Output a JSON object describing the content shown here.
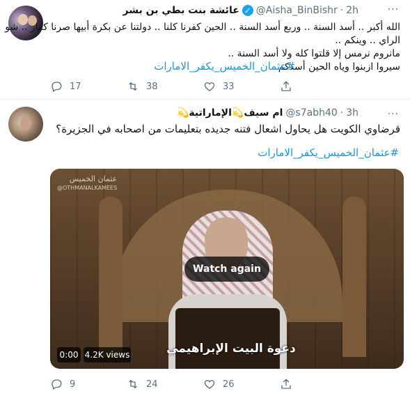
{
  "tweet1": {
    "name": "عائشة بنت بطي بن بشر",
    "handle": "@Aisha_BinBishr",
    "dot": "·",
    "time": "2h",
    "more": "···",
    "lines": [
      "الله أكبر .. أسد السنة .. وربع أسد السنة .. الحين كفرنا كلنا .. دولتنا عن بكرة أبيها صرنا كفار .. شو",
      "الراي .. وينكم ..",
      "مانروم نرمس إلا قلتوا كله ولا أسد السنة ..",
      "سيروا ازبنوا وياه الحين أسدكم"
    ],
    "hashtag": "#عثمان_الخميس_يكفر_الامارات",
    "reply_count": "17",
    "retweet_count": "38",
    "like_count": "33"
  },
  "tweet2": {
    "name": "ام سيف💫الإماراتية💫",
    "handle": "@s7abh40",
    "dot": "·",
    "time": "3h",
    "more": "···",
    "line1": "قرضاوي الكويت هل يحاول اشعال فتنه جديده بتعليمات من اصحابه في الجزيرة؟",
    "hashtag": "#عثمان_الخميس_يكفر_الامارات",
    "video": {
      "logo": "عثمان الخميس",
      "logo_sub": "@OTHMANALKAMEES",
      "caption": "دعوة البيت الإبراهيمي",
      "watch_again": "Watch again",
      "time": "0:00",
      "views": "4.2K views"
    },
    "reply_count": "9",
    "retweet_count": "24",
    "like_count": "26"
  },
  "colors": {
    "accent": "#1da1f2",
    "hashtag": "#1b95e0",
    "muted": "#5b7083"
  },
  "icons": {
    "reply": "reply-icon",
    "retweet": "retweet-icon",
    "like": "heart-icon",
    "share": "share-icon"
  }
}
